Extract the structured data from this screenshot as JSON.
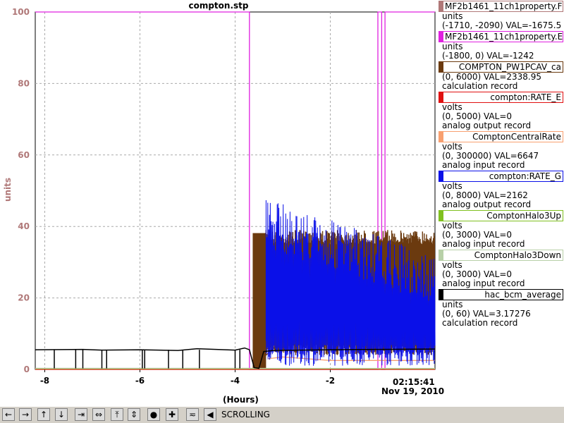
{
  "chart_data": {
    "type": "line",
    "title": "compton.stp",
    "ylabel": "units",
    "xlabel": "(Hours)",
    "timestamp": "02:15:41",
    "date": "Nov 19, 2010",
    "xlim": [
      -8.2,
      0.2
    ],
    "ylim": [
      0,
      100
    ],
    "x_ticks": [
      -8,
      -6,
      -4,
      -2
    ],
    "y_ticks": [
      0,
      20,
      40,
      60,
      80,
      100
    ],
    "grid": true,
    "series": [
      {
        "name": "MF2b1461_11ch1property.F",
        "color": "#b07878",
        "x": [
          -8.2,
          -3.62,
          -3.55,
          -3.0,
          -2.0,
          -1.0,
          0.2
        ],
        "y": [
          0.3,
          0.3,
          30,
          31.5,
          31.6,
          31.7,
          31.8
        ]
      },
      {
        "name": "MF2b1461_11ch1property.E",
        "color": "#e020e0",
        "x": [
          -8.2,
          -3.7,
          -3.7,
          -3.68,
          -1.0,
          -1.0,
          -0.92,
          -0.92,
          -0.85,
          -0.85,
          0.2
        ],
        "y": [
          100,
          100,
          0,
          0,
          0,
          100,
          100,
          0,
          0,
          100,
          100
        ]
      },
      {
        "name": "COMPTON_PW1PCAV_ca",
        "color": "#6b3a0f",
        "x": [
          -3.62,
          -3.62,
          -3.35,
          -3.35,
          -2.5,
          -1.5,
          -0.5,
          0.2
        ],
        "y": [
          0,
          38,
          38,
          4,
          14,
          12,
          12,
          12
        ],
        "band_low": 4,
        "band_high": 39
      },
      {
        "name": "compton:RATE_E",
        "color": "#e01010",
        "x": [
          -8.2,
          0.2
        ],
        "y": [
          0,
          0
        ]
      },
      {
        "name": "ComptonCentralRate",
        "color": "#f8a070",
        "x": [
          -3.3,
          -3.0,
          -2.0,
          -1.0,
          0.0,
          0.2
        ],
        "y": [
          3,
          3.5,
          2.5,
          2.5,
          2.5,
          2.5
        ]
      },
      {
        "name": "compton:RATE_G",
        "color": "#0a10e8",
        "x": [
          -3.35,
          -3.3,
          -3.2,
          -3.0,
          -2.8,
          -2.6,
          -2.4,
          -2.2,
          -2.0,
          -1.8,
          -1.6,
          -1.4,
          -1.2,
          -1.0,
          -0.8,
          -0.6,
          -0.4,
          -0.2,
          0.0,
          0.2
        ],
        "y": [
          0,
          50,
          45,
          46,
          42,
          43,
          44,
          41,
          40,
          39,
          38,
          36,
          37,
          38,
          35,
          34,
          33,
          32,
          33,
          32
        ]
      },
      {
        "name": "ComptonHalo3Up",
        "color": "#80c020",
        "x": [
          -8.2,
          0.2
        ],
        "y": [
          0.2,
          0.2
        ]
      },
      {
        "name": "ComptonHalo3Down",
        "color": "#b8d0a8",
        "x": [
          -8.2,
          0.2
        ],
        "y": [
          0.3,
          0.3
        ]
      },
      {
        "name": "hac_bcm_average",
        "color": "#000000",
        "x": [
          -8.2,
          -7.2,
          -6.8,
          -6.0,
          -5.2,
          -4.8,
          -4.0,
          -3.8,
          -3.7,
          -3.6,
          -3.5,
          -3.4,
          -3.2,
          -2.0,
          -1.0,
          0.2
        ],
        "y": [
          5.5,
          5.6,
          5.4,
          5.5,
          5.3,
          5.8,
          5.4,
          6.0,
          5.5,
          0.5,
          0.3,
          5.0,
          5.3,
          5.5,
          5.6,
          5.7
        ]
      }
    ]
  },
  "legend": [
    {
      "name": "MF2b1461_11ch1property.F",
      "lines": [
        "units",
        "(-1710, -2090) VAL=-1675.5"
      ],
      "color": "#b07878"
    },
    {
      "name": "MF2b1461_11ch1property.E",
      "lines": [
        "units",
        "(-1800, 0) VAL=-1242"
      ],
      "color": "#e020e0"
    },
    {
      "name": "COMPTON_PW1PCAV_ca",
      "lines": [
        "(0, 6000) VAL=2338.95",
        "calculation record"
      ],
      "color": "#6b3a0f"
    },
    {
      "name": "compton:RATE_E",
      "lines": [
        "volts",
        "(0, 5000) VAL=0",
        "analog output record"
      ],
      "color": "#e01010"
    },
    {
      "name": "ComptonCentralRate",
      "lines": [
        "volts",
        "(0, 300000) VAL=6647",
        "analog input record"
      ],
      "color": "#f8a070"
    },
    {
      "name": "compton:RATE_G",
      "lines": [
        "volts",
        "(0, 8000) VAL=2162",
        "analog output record"
      ],
      "color": "#0a10e8"
    },
    {
      "name": "ComptonHalo3Up",
      "lines": [
        "volts",
        "(0, 3000) VAL=0",
        "analog input record"
      ],
      "color": "#80c020"
    },
    {
      "name": "ComptonHalo3Down",
      "lines": [
        "volts",
        "(0, 3000) VAL=0",
        "analog input record"
      ],
      "color": "#b8d0a8"
    },
    {
      "name": "hac_bcm_average",
      "lines": [
        "units",
        "(0, 60) VAL=3.17276",
        "calculation record"
      ],
      "color": "#000000"
    }
  ],
  "toolbar": {
    "buttons": [
      {
        "name": "scroll-left-button",
        "glyph": "←"
      },
      {
        "name": "scroll-right-button",
        "glyph": "→"
      },
      {
        "name": "scroll-up-button",
        "glyph": "↑"
      },
      {
        "name": "scroll-down-button",
        "glyph": "↓"
      },
      {
        "name": "zoom-in-x-button",
        "glyph": "⇥"
      },
      {
        "name": "zoom-out-x-button",
        "glyph": "⇔"
      },
      {
        "name": "zoom-in-y-button",
        "glyph": "⤒"
      },
      {
        "name": "zoom-out-y-button",
        "glyph": "⇕"
      },
      {
        "name": "config-button",
        "glyph": "●"
      },
      {
        "name": "add-button",
        "glyph": "✚"
      },
      {
        "name": "auto-scale-button",
        "glyph": "≂"
      },
      {
        "name": "back-button",
        "glyph": "◀"
      }
    ],
    "mode": "SCROLLING"
  }
}
